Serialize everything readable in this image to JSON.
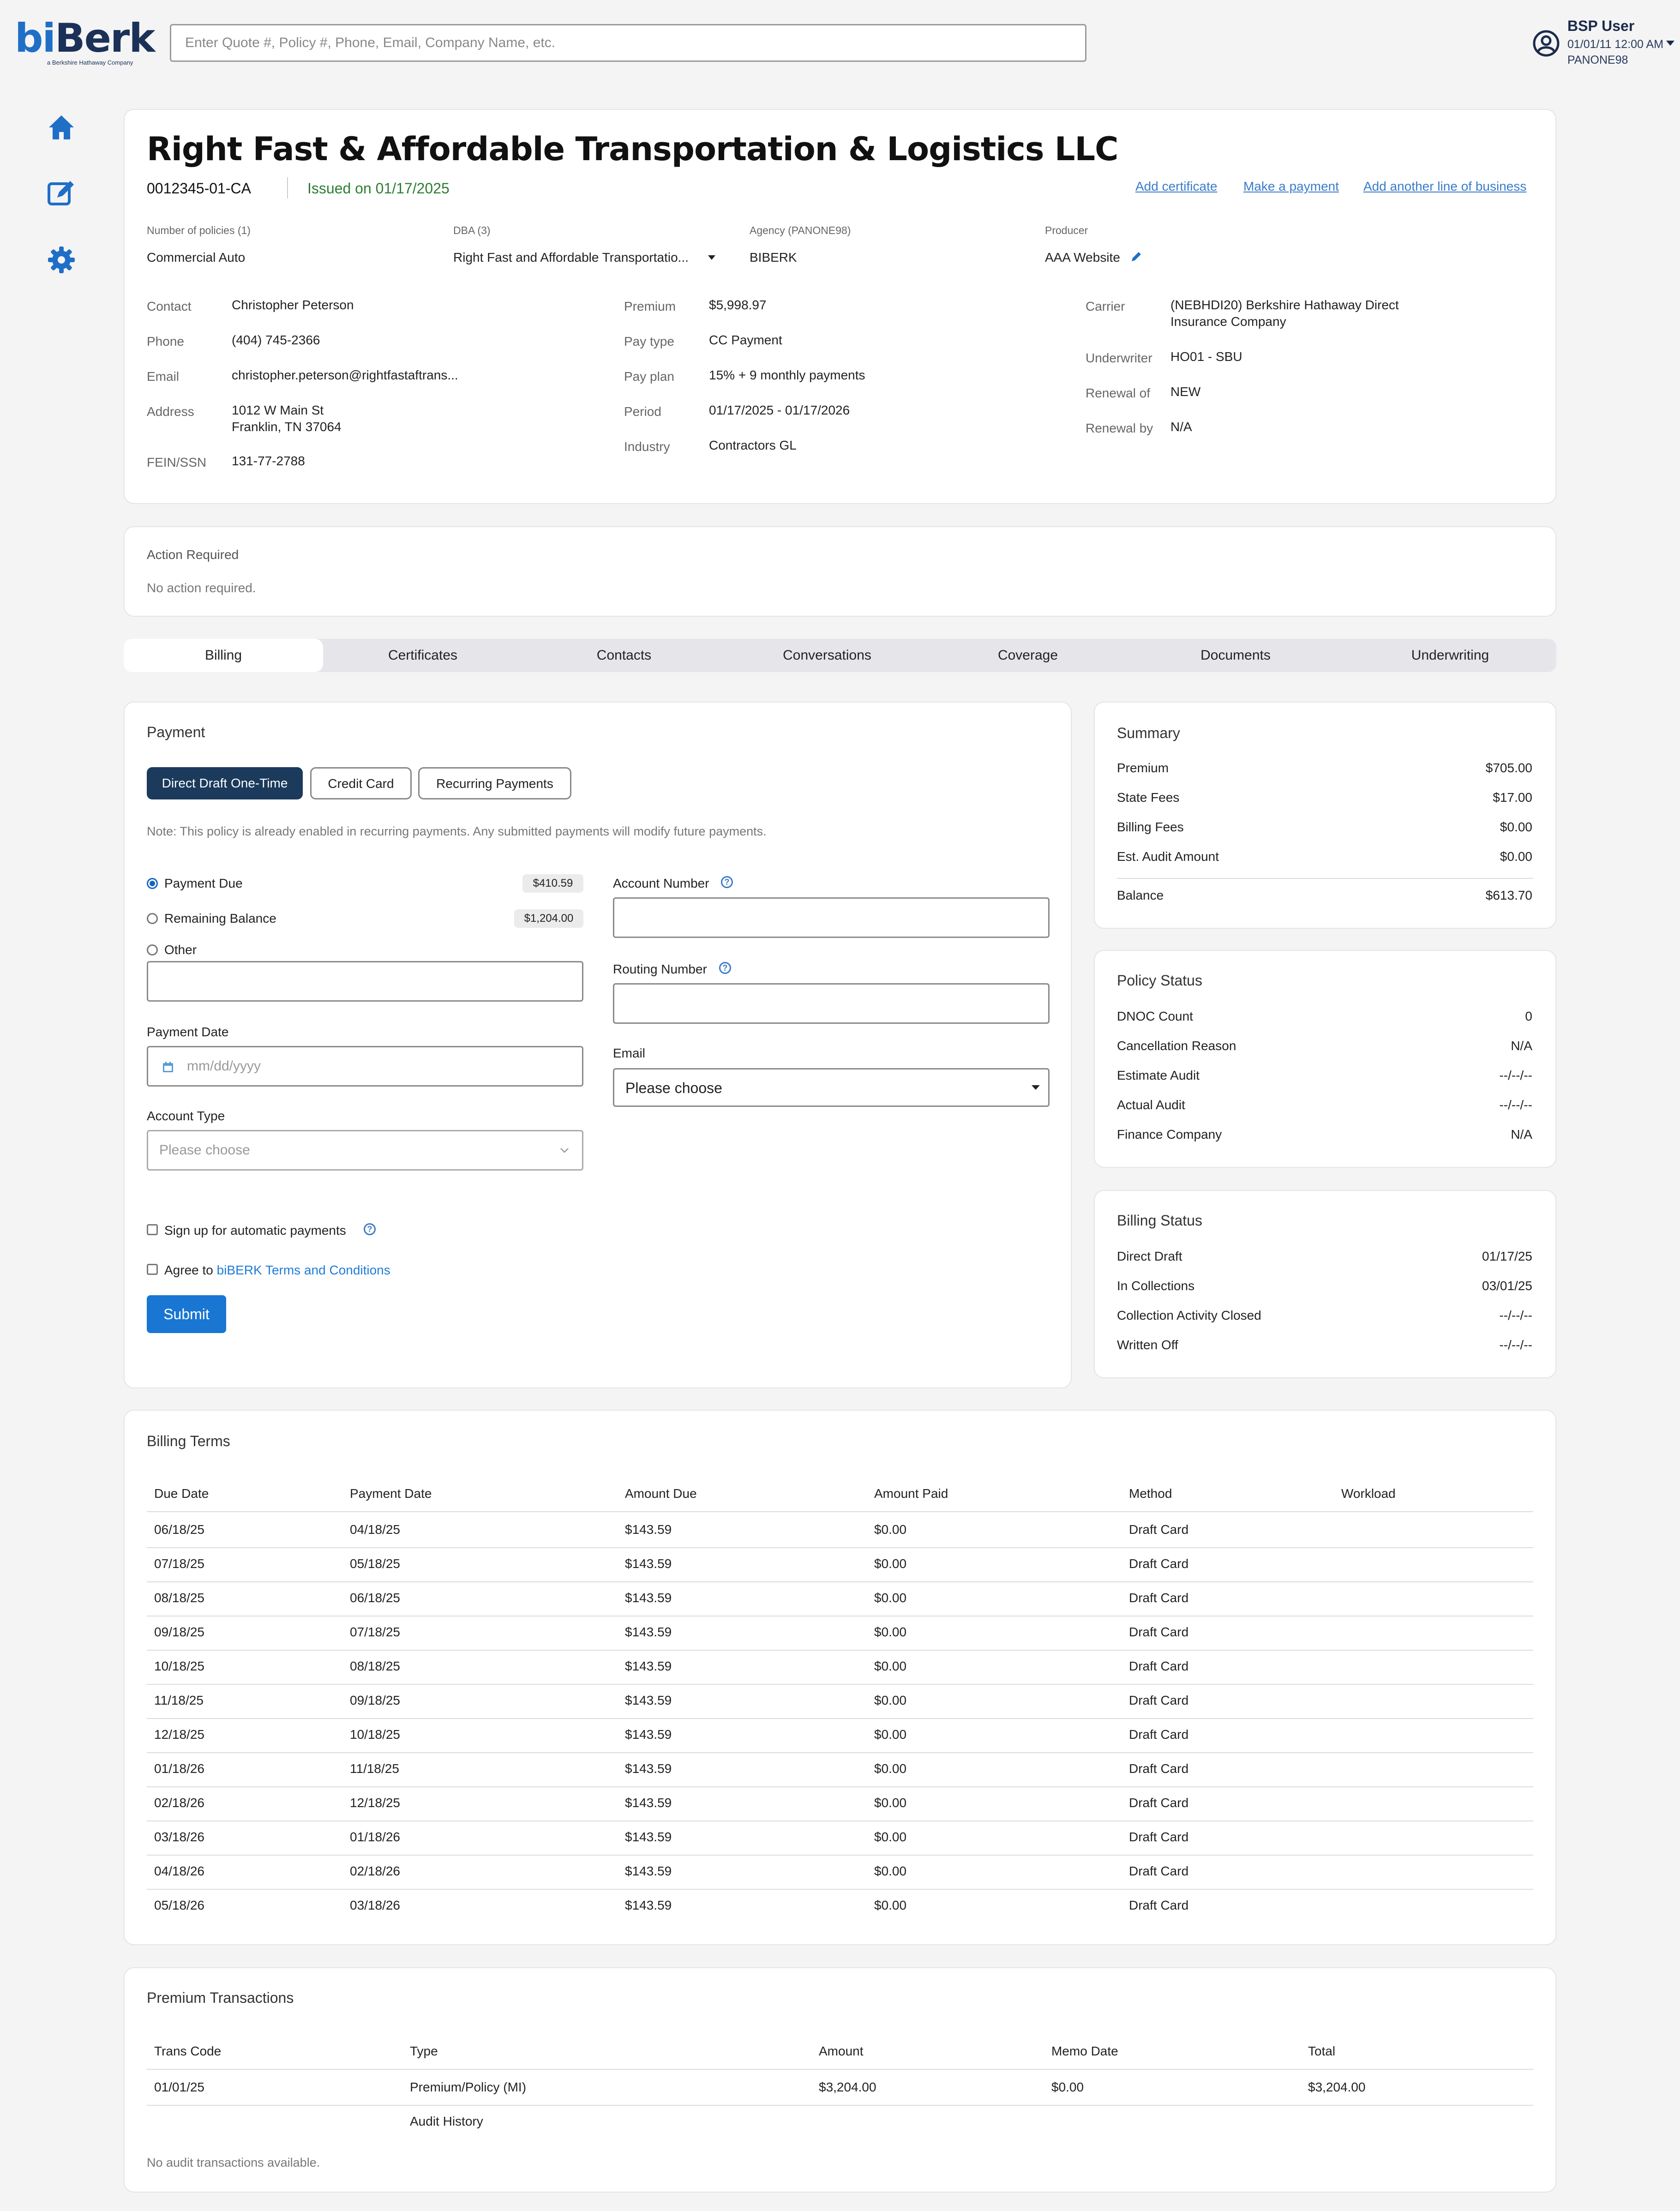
{
  "header": {
    "logo_text": "biBerk",
    "logo_subtitle": "a Berkshire Hathaway Company",
    "search_placeholder": "Enter Quote #, Policy #, Phone, Email, Company Name, etc.",
    "user": {
      "name": "BSP User",
      "datetime": "01/01/11 12:00 AM",
      "agency": "PANONE98"
    }
  },
  "nav": [
    "home-icon",
    "edit-icon",
    "gear-icon"
  ],
  "colors": {
    "brand_blue": "#1f6fc7",
    "navy": "#1b3a5c",
    "submit_blue": "#1976d2",
    "issued_green": "#2e7d32",
    "link_blue": "#3a7bc8"
  },
  "policy": {
    "company_name": "Right Fast & Affordable Transportation & Logistics LLC",
    "policy_number": "0012345-01-CA",
    "issued": "Issued on 01/17/2025",
    "links": {
      "add_certificate": "Add certificate",
      "make_payment": "Make a payment",
      "add_line": "Add another line of business"
    },
    "meta": {
      "policies_label": "Number of policies (1)",
      "policies_value": "Commercial Auto",
      "dba_label": "DBA (3)",
      "dba_value": "Right Fast and Affordable Transportatio...",
      "agency_label": "Agency (PANONE98)",
      "agency_value": "BIBERK",
      "producer_label": "Producer",
      "producer_value": "AAA Website"
    },
    "contact": {
      "contact_k": "Contact",
      "contact_v": "Christopher Peterson",
      "phone_k": "Phone",
      "phone_v": "(404) 745-2366",
      "email_k": "Email",
      "email_v": "christopher.peterson@rightfastaftrans...",
      "address_k": "Address",
      "address_v1": "1012 W Main St",
      "address_v2": "Franklin, TN 37064",
      "fein_k": "FEIN/SSN",
      "fein_v": "131-77-2788"
    },
    "premium": {
      "premium_k": "Premium",
      "premium_v": "$5,998.97",
      "paytype_k": "Pay type",
      "paytype_v": "CC Payment",
      "payplan_k": "Pay plan",
      "payplan_v": "15% + 9 monthly payments",
      "period_k": "Period",
      "period_v": "01/17/2025 - 01/17/2026",
      "industry_k": "Industry",
      "industry_v": "Contractors GL"
    },
    "carrier": {
      "carrier_k": "Carrier",
      "carrier_v1": "(NEBHDI20) Berkshire Hathaway Direct",
      "carrier_v2": "Insurance Company",
      "underwriter_k": "Underwriter",
      "underwriter_v": "HO01 - SBU",
      "renewal_of_k": "Renewal of",
      "renewal_of_v": "NEW",
      "renewal_by_k": "Renewal by",
      "renewal_by_v": "N/A"
    }
  },
  "action": {
    "title": "Action Required",
    "text": "No action required."
  },
  "tabs": [
    "Billing",
    "Certificates",
    "Contacts",
    "Conversations",
    "Coverage",
    "Documents",
    "Underwriting"
  ],
  "payment": {
    "title": "Payment",
    "methods": [
      "Direct Draft One-Time",
      "Credit Card",
      "Recurring Payments"
    ],
    "note": "Note: This policy is already enabled in recurring payments. Any submitted payments will modify future payments.",
    "payment_due": "Payment Due",
    "payment_due_amt": "$410.59",
    "remaining": "Remaining Balance",
    "remaining_amt": "$1,204.00",
    "other": "Other",
    "payment_date_label": "Payment Date",
    "payment_date_placeholder": "mm/dd/yyyy",
    "account_type_label": "Account Type",
    "account_type_placeholder": "Please choose",
    "account_number_label": "Account Number",
    "routing_number_label": "Routing Number",
    "email_label": "Email",
    "email_placeholder": "Please choose",
    "auto_payments": "Sign up for automatic payments",
    "agree_prefix": "Agree to ",
    "agree_link": "biBERK Terms and Conditions",
    "submit": "Submit"
  },
  "summary": {
    "title": "Summary",
    "rows": [
      [
        "Premium",
        "$705.00"
      ],
      [
        "State Fees",
        "$17.00"
      ],
      [
        "Billing Fees",
        "$0.00"
      ],
      [
        "Est. Audit Amount",
        "$0.00"
      ]
    ],
    "balance_label": "Balance",
    "balance_value": "$613.70"
  },
  "policy_status": {
    "title": "Policy Status",
    "rows": [
      [
        "DNOC Count",
        "0"
      ],
      [
        "Cancellation Reason",
        "N/A"
      ],
      [
        "Estimate Audit",
        "--/--/--"
      ],
      [
        "Actual Audit",
        "--/--/--"
      ],
      [
        "Finance Company",
        "N/A"
      ]
    ]
  },
  "billing_status": {
    "title": "Billing Status",
    "rows": [
      [
        "Direct Draft",
        "01/17/25"
      ],
      [
        "In Collections",
        "03/01/25"
      ],
      [
        "Collection Activity Closed",
        "--/--/--"
      ],
      [
        "Written Off",
        "--/--/--"
      ]
    ]
  },
  "billing_terms": {
    "title": "Billing Terms",
    "headers": [
      "Due Date",
      "Payment Date",
      "Amount Due",
      "Amount Paid",
      "Method",
      "Workload"
    ],
    "rows": [
      [
        "06/18/25",
        "04/18/25",
        "$143.59",
        "$0.00",
        "Draft Card",
        ""
      ],
      [
        "07/18/25",
        "05/18/25",
        "$143.59",
        "$0.00",
        "Draft Card",
        ""
      ],
      [
        "08/18/25",
        "06/18/25",
        "$143.59",
        "$0.00",
        "Draft Card",
        ""
      ],
      [
        "09/18/25",
        "07/18/25",
        "$143.59",
        "$0.00",
        "Draft Card",
        ""
      ],
      [
        "10/18/25",
        "08/18/25",
        "$143.59",
        "$0.00",
        "Draft Card",
        ""
      ],
      [
        "11/18/25",
        "09/18/25",
        "$143.59",
        "$0.00",
        "Draft Card",
        ""
      ],
      [
        "12/18/25",
        "10/18/25",
        "$143.59",
        "$0.00",
        "Draft Card",
        ""
      ],
      [
        "01/18/26",
        "11/18/25",
        "$143.59",
        "$0.00",
        "Draft Card",
        ""
      ],
      [
        "02/18/26",
        "12/18/25",
        "$143.59",
        "$0.00",
        "Draft Card",
        ""
      ],
      [
        "03/18/26",
        "01/18/26",
        "$143.59",
        "$0.00",
        "Draft Card",
        ""
      ],
      [
        "04/18/26",
        "02/18/26",
        "$143.59",
        "$0.00",
        "Draft Card",
        ""
      ],
      [
        "05/18/26",
        "03/18/26",
        "$143.59",
        "$0.00",
        "Draft Card",
        ""
      ]
    ]
  },
  "premium_transactions": {
    "title": "Premium Transactions",
    "headers": [
      "Trans Code",
      "Type",
      "Amount",
      "Memo Date",
      "Total"
    ],
    "rows": [
      [
        "01/01/25",
        "Premium/Policy (MI)",
        "$3,204.00",
        "$0.00",
        "$3,204.00"
      ]
    ],
    "audit_history": "Audit History",
    "empty": "No audit transactions available."
  }
}
